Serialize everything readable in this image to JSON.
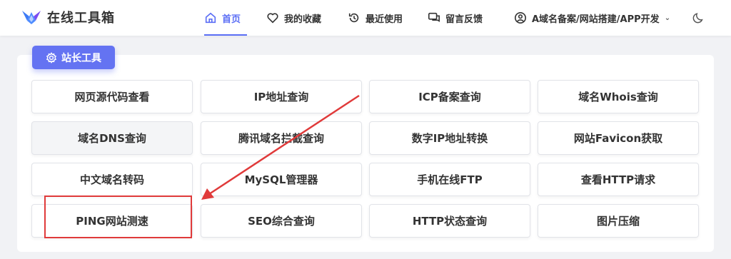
{
  "header": {
    "logo_text": "在线工具箱",
    "nav": [
      {
        "label": "首页",
        "icon": "home-icon",
        "active": true
      },
      {
        "label": "我的收藏",
        "icon": "heart-icon"
      },
      {
        "label": "最近使用",
        "icon": "history-icon"
      },
      {
        "label": "留言反馈",
        "icon": "chat-icon"
      },
      {
        "label": "A域名备案/网站搭建/APP开发",
        "icon": "user-icon"
      }
    ]
  },
  "section": {
    "title": "站长工具",
    "icon": "gear-icon"
  },
  "tools": [
    "网页源代码查看",
    "IP地址查询",
    "ICP备案查询",
    "域名Whois查询",
    "域名DNS查询",
    "腾讯域名拦截查询",
    "数字IP地址转换",
    "网站Favicon获取",
    "中文域名转码",
    "MySQL管理器",
    "手机在线FTP",
    "查看HTTP请求",
    "PING网站测速",
    "SEO综合查询",
    "HTTP状态查询",
    "图片压缩"
  ],
  "colors": {
    "accent": "#5b6ef5",
    "annotation": "#e03a3a"
  }
}
